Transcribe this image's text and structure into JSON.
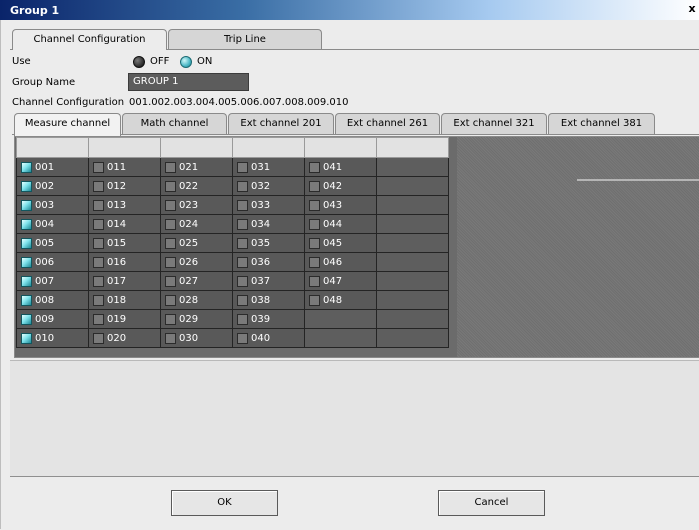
{
  "window": {
    "title": "Group 1",
    "close_label": "x"
  },
  "main_tabs": [
    {
      "label": "Channel Configuration",
      "active": true
    },
    {
      "label": "Trip Line",
      "active": false
    }
  ],
  "form": {
    "use_label": "Use",
    "off_label": "OFF",
    "on_label": "ON",
    "use_selected": "ON",
    "group_name_label": "Group Name",
    "group_name_value": "GROUP 1",
    "channel_config_label": "Channel Configuration",
    "channel_config_value": "001.002.003.004.005.006.007.008.009.010"
  },
  "sub_tabs": [
    {
      "label": "Measure channel",
      "active": true
    },
    {
      "label": "Math channel",
      "active": false
    },
    {
      "label": "Ext channel 201",
      "active": false
    },
    {
      "label": "Ext channel 261",
      "active": false
    },
    {
      "label": "Ext channel 321",
      "active": false
    },
    {
      "label": "Ext channel 381",
      "active": false
    }
  ],
  "channel_grid": {
    "rows": [
      [
        {
          "label": "001",
          "checked": true
        },
        {
          "label": "011",
          "checked": false
        },
        {
          "label": "021",
          "checked": false
        },
        {
          "label": "031",
          "checked": false
        },
        {
          "label": "041",
          "checked": false
        },
        null
      ],
      [
        {
          "label": "002",
          "checked": true
        },
        {
          "label": "012",
          "checked": false
        },
        {
          "label": "022",
          "checked": false
        },
        {
          "label": "032",
          "checked": false
        },
        {
          "label": "042",
          "checked": false
        },
        null
      ],
      [
        {
          "label": "003",
          "checked": true
        },
        {
          "label": "013",
          "checked": false
        },
        {
          "label": "023",
          "checked": false
        },
        {
          "label": "033",
          "checked": false
        },
        {
          "label": "043",
          "checked": false
        },
        null
      ],
      [
        {
          "label": "004",
          "checked": true
        },
        {
          "label": "014",
          "checked": false
        },
        {
          "label": "024",
          "checked": false
        },
        {
          "label": "034",
          "checked": false
        },
        {
          "label": "044",
          "checked": false
        },
        null
      ],
      [
        {
          "label": "005",
          "checked": true
        },
        {
          "label": "015",
          "checked": false
        },
        {
          "label": "025",
          "checked": false
        },
        {
          "label": "035",
          "checked": false
        },
        {
          "label": "045",
          "checked": false
        },
        null
      ],
      [
        {
          "label": "006",
          "checked": true
        },
        {
          "label": "016",
          "checked": false
        },
        {
          "label": "026",
          "checked": false
        },
        {
          "label": "036",
          "checked": false
        },
        {
          "label": "046",
          "checked": false
        },
        null
      ],
      [
        {
          "label": "007",
          "checked": true
        },
        {
          "label": "017",
          "checked": false
        },
        {
          "label": "027",
          "checked": false
        },
        {
          "label": "037",
          "checked": false
        },
        {
          "label": "047",
          "checked": false
        },
        null
      ],
      [
        {
          "label": "008",
          "checked": true
        },
        {
          "label": "018",
          "checked": false
        },
        {
          "label": "028",
          "checked": false
        },
        {
          "label": "038",
          "checked": false
        },
        {
          "label": "048",
          "checked": false
        },
        null
      ],
      [
        {
          "label": "009",
          "checked": true
        },
        {
          "label": "019",
          "checked": false
        },
        {
          "label": "029",
          "checked": false
        },
        {
          "label": "039",
          "checked": false
        },
        null,
        null
      ],
      [
        {
          "label": "010",
          "checked": true
        },
        {
          "label": "020",
          "checked": false
        },
        {
          "label": "030",
          "checked": false
        },
        {
          "label": "040",
          "checked": false
        },
        null,
        null
      ]
    ]
  },
  "buttons": {
    "ok_label": "OK",
    "cancel_label": "Cancel"
  },
  "colors": {
    "checkbox_checked": "#4fc3cf",
    "cell_background": "#595959",
    "title_bar": "#0a246a"
  }
}
